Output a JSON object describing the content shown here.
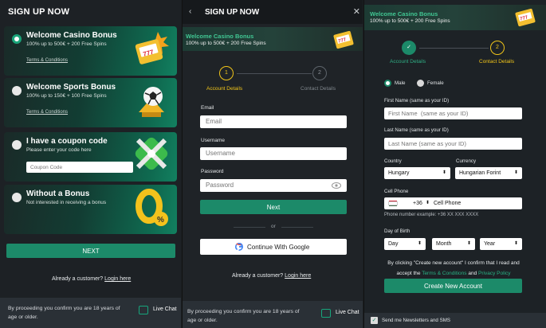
{
  "panel1": {
    "title": "SIGN UP NOW",
    "bonuses": [
      {
        "title": "Welcome Casino Bonus",
        "subtitle": "100% up to 500€ + 200 Free Spins",
        "terms": "Terms & Conditions",
        "art": "slot-machine-icon",
        "selected": true
      },
      {
        "title": "Welcome Sports Bonus",
        "subtitle": "100% up to 150€ + 100 Free Spins",
        "terms": "Terms & Conditions",
        "art": "soccer-ball-icon",
        "selected": false
      },
      {
        "title": "I have a coupon code",
        "subtitle": "Please enter your code here",
        "input_placeholder": "Coupon Code",
        "art": "gift-icon",
        "selected": false
      },
      {
        "title": "Without a Bonus",
        "subtitle": "Not interested in receiving a bonus",
        "art": "zero-percent-icon",
        "selected": false
      }
    ],
    "next_label": "NEXT",
    "already_text": "Already a customer?",
    "login_label": "Login here",
    "footer_text": "By proceeding you confirm you are 18 years of age or older.",
    "live_chat": "Live Chat"
  },
  "panel2": {
    "back_icon": "chevron-left-icon",
    "title": "SIGN UP NOW",
    "close_icon": "close-icon",
    "promo_title": "Welcome Casino Bonus",
    "promo_sub": "100% up to 500€ + 200 Free Spins",
    "steps": [
      {
        "num": "1",
        "label": "Account Details",
        "active": true
      },
      {
        "num": "2",
        "label": "Contact Details",
        "active": false
      }
    ],
    "email_label": "Email",
    "email_placeholder": "Email",
    "username_label": "Username",
    "username_placeholder": "Username",
    "password_label": "Password",
    "password_placeholder": "Password",
    "next_label": "Next",
    "or_label": "or",
    "google_label": "Continue With Google",
    "already_text": "Already a customer?",
    "login_label": "Login here",
    "footer_text": "By proceeding you confirm you are 18 years of age or older.",
    "live_chat": "Live Chat"
  },
  "panel3": {
    "promo_title": "Welcome Casino Bonus",
    "promo_sub": "100% up to 500€ + 200 Free Spins",
    "steps": [
      {
        "num": "✓",
        "label": "Account Details",
        "done": true
      },
      {
        "num": "2",
        "label": "Contact Details",
        "active": true
      }
    ],
    "gender": {
      "male": "Male",
      "female": "Female",
      "selected": "Male"
    },
    "first_name_label": "First Name (same as your ID)",
    "first_name_placeholder": "First Name  (same as your ID)",
    "last_name_label": "Last Name (same as your ID)",
    "last_name_placeholder": "Last Name (same as your ID)",
    "country_label": "Country",
    "country_value": "Hungary",
    "currency_label": "Currency",
    "currency_value": "Hungarian Forint",
    "phone_label": "Cell Phone",
    "phone_code": "+36",
    "phone_placeholder": "Cell Phone",
    "phone_hint": "Phone number example: +36 XX XXX XXXX",
    "dob_label": "Day of Birth",
    "day": "Day",
    "month": "Month",
    "year": "Year",
    "consent_pre": "By clicking \"Create new account\" I confirm that I read and accept the",
    "terms_link": "Terms & Conditions",
    "and": "and",
    "privacy_link": "Privacy Policy",
    "create_label": "Create New Account",
    "newsletter_label": "Send me Newsletters and SMS"
  }
}
